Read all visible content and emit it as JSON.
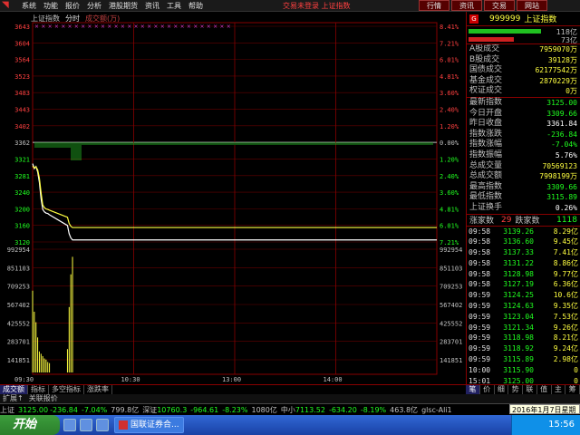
{
  "menubar": {
    "items": [
      "系统",
      "功能",
      "报价",
      "分析",
      "港股期货",
      "资讯",
      "工具",
      "帮助"
    ],
    "center_text": "交易未登录  上证指数",
    "right_buttons": [
      "行情",
      "资讯",
      "交易",
      "网站"
    ]
  },
  "chart_header": {
    "name": "上证指数",
    "mode": "分时",
    "vol_label": "成交额(万)"
  },
  "chart_data": {
    "type": "line",
    "title": "上证指数 分时",
    "x_ticks": [
      "09:30",
      "10:30",
      "13:00",
      "14:00"
    ],
    "price_axis": [
      "3643",
      "3604",
      "3564",
      "3523",
      "3483",
      "3443",
      "3402",
      "3362",
      "3321",
      "3281",
      "3240",
      "3200",
      "3160",
      "3120"
    ],
    "pct_axis": [
      "8.41%",
      "7.21%",
      "6.01%",
      "4.81%",
      "3.60%",
      "2.40%",
      "1.20%",
      "0.00%",
      "1.20%",
      "2.40%",
      "3.60%",
      "4.81%",
      "6.01%",
      "7.21%"
    ],
    "vol_axis": [
      "992954",
      "851103",
      "709253",
      "567402",
      "425552",
      "283701",
      "141851"
    ],
    "prev_close": 3361.84,
    "ylim": [
      3120,
      3643
    ],
    "series": [
      {
        "name": "上证指数",
        "color": "#ffffff",
        "x_minutes": [
          0,
          1,
          2,
          3,
          4,
          5,
          6,
          7,
          8,
          9,
          10,
          11,
          12,
          13,
          14
        ],
        "values": [
          3310,
          3298,
          3303,
          3290,
          3265,
          3225,
          3199,
          3193,
          3190,
          3189,
          3186,
          3160,
          3140,
          3130,
          3125
        ]
      },
      {
        "name": "均价",
        "color": "#ffff40",
        "x_minutes": [
          0,
          1,
          2,
          3,
          4,
          5,
          6,
          7,
          8,
          9,
          10,
          11,
          12,
          13,
          14
        ],
        "values": [
          3304,
          3300,
          3302,
          3295,
          3275,
          3240,
          3210,
          3203,
          3200,
          3199,
          3197,
          3180,
          3165,
          3158,
          3155
        ]
      }
    ],
    "volume_bars": [
      700000,
      520000,
      430000,
      300000,
      180000,
      160000,
      140000,
      120000,
      110000,
      90000,
      80000,
      200000,
      560000,
      840000,
      990000
    ]
  },
  "right_panel": {
    "code": "999999",
    "name": "上证指数",
    "tag": "G",
    "bar_up": "118亿",
    "bar_down": "73亿",
    "stats1": [
      {
        "k": "A股成交",
        "v": "7959070万"
      },
      {
        "k": "B股成交",
        "v": "39128万"
      },
      {
        "k": "国债成交",
        "v": "62177542万"
      },
      {
        "k": "基金成交",
        "v": "2870229万"
      },
      {
        "k": "权证成交",
        "v": "0万"
      }
    ],
    "stats2": [
      {
        "k": "最新指数",
        "v": "3125.00",
        "c": "#20ff20"
      },
      {
        "k": "今日开盘",
        "v": "3309.66",
        "c": "#20ff20"
      },
      {
        "k": "昨日收盘",
        "v": "3361.84",
        "c": "#ffffff"
      },
      {
        "k": "指数涨跌",
        "v": "-236.84",
        "c": "#20ff20"
      },
      {
        "k": "指数涨幅",
        "v": "-7.04%",
        "c": "#20ff20"
      },
      {
        "k": "指数振幅",
        "v": "5.76%",
        "c": "#ffffff"
      },
      {
        "k": "总成交量",
        "v": "70569123",
        "c": "#ffff40"
      },
      {
        "k": "总成交额",
        "v": "7998199万",
        "c": "#ffff40"
      },
      {
        "k": "最高指数",
        "v": "3309.66",
        "c": "#20ff20"
      },
      {
        "k": "最低指数",
        "v": "3115.89",
        "c": "#20ff20"
      },
      {
        "k": "上证换手",
        "v": "0.26%",
        "c": "#ffffff"
      }
    ],
    "counts": {
      "label_up": "涨家数",
      "up": "29",
      "label_down": "跌家数",
      "down": "1118"
    },
    "ticks": [
      {
        "t": "09:58",
        "p": "3139.26",
        "v": "8.29亿"
      },
      {
        "t": "09:58",
        "p": "3136.60",
        "v": "9.45亿"
      },
      {
        "t": "09:58",
        "p": "3137.33",
        "v": "7.41亿"
      },
      {
        "t": "09:58",
        "p": "3131.22",
        "v": "8.86亿"
      },
      {
        "t": "09:58",
        "p": "3128.98",
        "v": "9.77亿"
      },
      {
        "t": "09:58",
        "p": "3127.19",
        "v": "6.36亿"
      },
      {
        "t": "09:59",
        "p": "3124.25",
        "v": "10.6亿"
      },
      {
        "t": "09:59",
        "p": "3124.63",
        "v": "9.35亿"
      },
      {
        "t": "09:59",
        "p": "3123.04",
        "v": "7.53亿"
      },
      {
        "t": "09:59",
        "p": "3121.34",
        "v": "9.26亿"
      },
      {
        "t": "09:59",
        "p": "3118.98",
        "v": "8.21亿"
      },
      {
        "t": "09:59",
        "p": "3118.92",
        "v": "9.24亿"
      },
      {
        "t": "09:59",
        "p": "3115.89",
        "v": "2.98亿"
      },
      {
        "t": "10:00",
        "p": "3115.90",
        "v": "0"
      },
      {
        "t": "15:01",
        "p": "3125.00",
        "v": "0"
      }
    ]
  },
  "bottom_tabs": [
    "成交额",
    "指标",
    "多空指标",
    "涨跌率"
  ],
  "right_tabs": [
    "笔",
    "价",
    "细",
    "势",
    "联",
    "值",
    "主",
    "筹"
  ],
  "bottom_tabs2": [
    "扩展↑",
    "关联报价"
  ],
  "statusbar": {
    "sh_label": "上证",
    "sh_val": "3125.00",
    "sh_chg": "-236.84",
    "sh_pct": "-7.04%",
    "sh_amt": "799.8亿",
    "sz_label": "深证",
    "sz_val": "10760.3",
    "sz_chg": "-964.61",
    "sz_pct": "-8.23%",
    "sz_amt": "1080亿",
    "zx_label": "中小",
    "zx_val": "7113.52",
    "zx_chg": "-634.20",
    "zx_pct": "-8.19%",
    "zx_amt": "463.8亿",
    "server": "glsc-Ali1"
  },
  "date_tip": "2016年1月7日星期四",
  "taskbar": {
    "start": "开始",
    "task_label": "国联证券合...",
    "clock": "15:56"
  }
}
